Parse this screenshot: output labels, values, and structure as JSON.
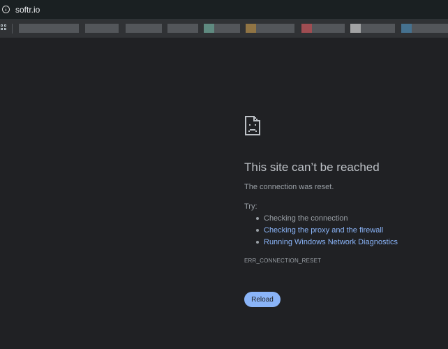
{
  "address_bar": {
    "url": "softr.io",
    "icon": "info-icon"
  },
  "bookmarks_bar": {
    "apps_icon": "apps-grid-icon"
  },
  "error_page": {
    "icon": "sad-page-icon",
    "title": "This site can’t be reached",
    "subtitle": "The connection was reset.",
    "try_label": "Try:",
    "suggestions": [
      {
        "label": "Checking the connection",
        "is_link": false
      },
      {
        "label": "Checking the proxy and the firewall",
        "is_link": true
      },
      {
        "label": "Running Windows Network Diagnostics",
        "is_link": true
      }
    ],
    "error_code": "ERR_CONNECTION_RESET",
    "reload_label": "Reload"
  },
  "colors": {
    "page_background": "#202124",
    "title_text": "#bdc1c6",
    "body_text": "#9aa0a6",
    "link": "#8ab4f8",
    "button_background": "#8ab4f8"
  }
}
